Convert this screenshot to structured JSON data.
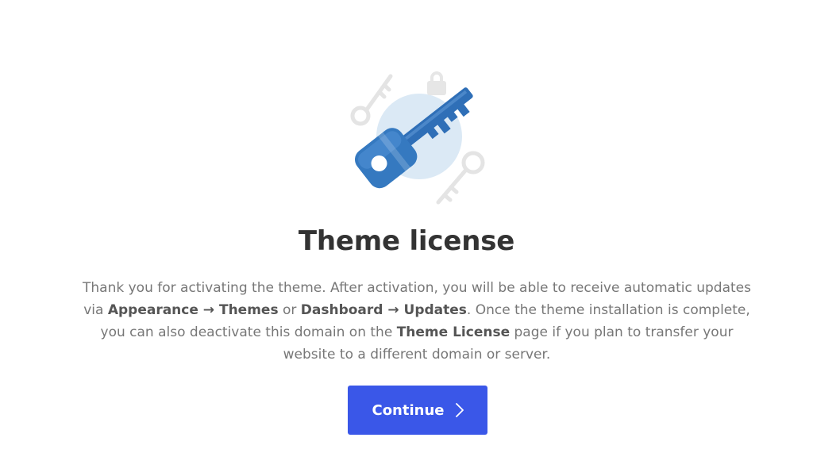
{
  "illustration": {
    "icon": "key-icon",
    "accent_color": "#2f6fb7",
    "circle_color": "#dbe9f5",
    "decor_color": "#e6e6e6"
  },
  "page": {
    "title": "Theme license"
  },
  "description": {
    "part1": "Thank you for activating the theme. After activation, you will be able to receive automatic updates via ",
    "appearance_path": "Appearance → Themes",
    "or": " or ",
    "dashboard_path": "Dashboard → Updates",
    "part2": ". Once the theme installation is complete, you can also deactivate this domain on the ",
    "license_page": "Theme License",
    "part3": " page if you plan to transfer your website to a different domain or server."
  },
  "actions": {
    "continue_label": "Continue",
    "continue_icon": "chevron-right-icon",
    "button_color": "#3a57e8"
  }
}
